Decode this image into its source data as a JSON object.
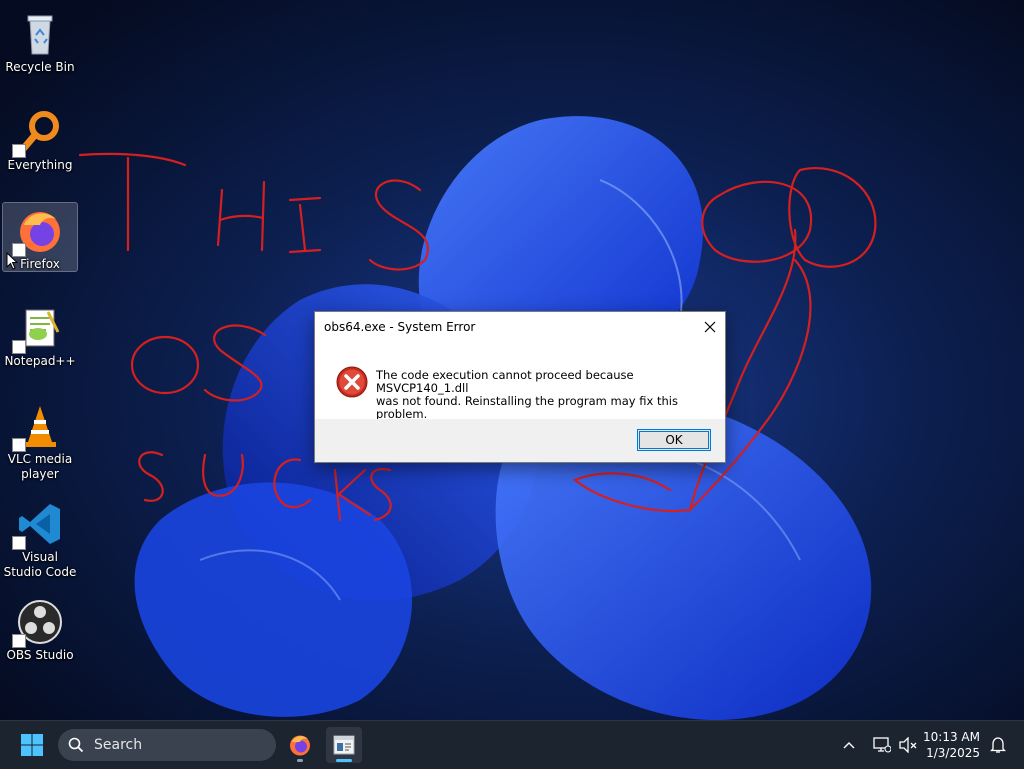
{
  "desktop": {
    "icons": [
      {
        "label": "Recycle Bin",
        "icon": "recycle-bin-icon"
      },
      {
        "label": "Everything",
        "icon": "everything-search-icon"
      },
      {
        "label": "Firefox",
        "icon": "firefox-icon"
      },
      {
        "label": "Notepad++",
        "icon": "notepad-plus-plus-icon"
      },
      {
        "label": "VLC media player",
        "icon": "vlc-cone-icon"
      },
      {
        "label": "Visual Studio Code",
        "icon": "vscode-icon"
      },
      {
        "label": "OBS Studio",
        "icon": "obs-studio-icon"
      }
    ],
    "selected_icon": "Firefox",
    "scribble_text": [
      "THIS",
      "OS",
      "SUCKS"
    ],
    "scribble_color": "#d42020"
  },
  "dialog": {
    "title": "obs64.exe - System Error",
    "message_line1": "The code execution cannot proceed because MSVCP140_1.dll",
    "message_line2": "was not found. Reinstalling the program may fix this problem.",
    "ok_label": "OK",
    "icon": "error-icon"
  },
  "taskbar": {
    "search_placeholder": "Search",
    "pinned": [
      "windows-start-icon",
      "firefox-icon",
      "dialog-window-icon"
    ],
    "time": "10:13 AM",
    "date": "1/3/2025",
    "tray_icons": [
      "chevron-up-icon",
      "network-icon",
      "volume-muted-icon",
      "notification-bell-icon"
    ],
    "accent": "#4cc2ff"
  }
}
